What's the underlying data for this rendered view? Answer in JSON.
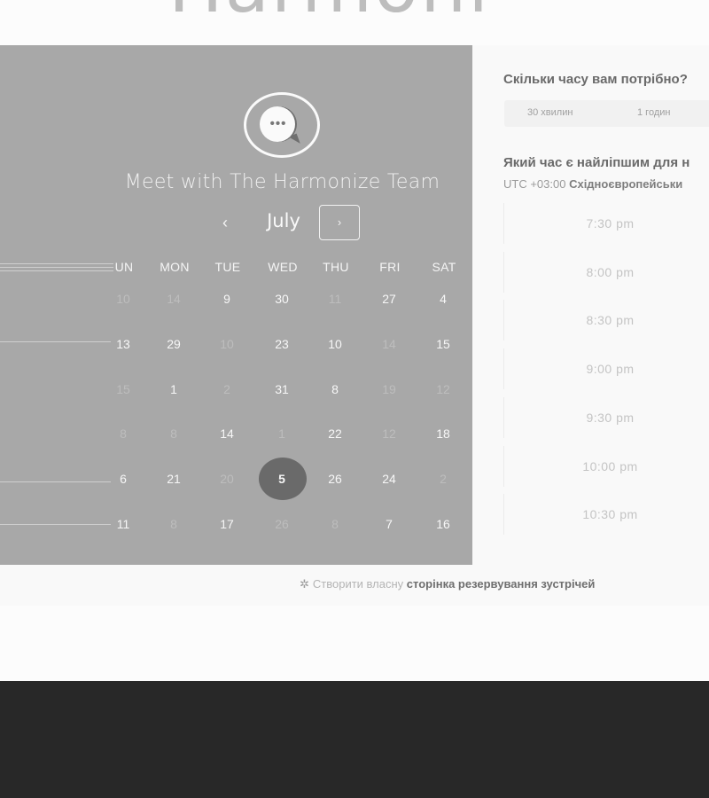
{
  "brand": {
    "partial_text": "Harmoni",
    "color": "#bdbdbd"
  },
  "calendar": {
    "title": "Meet with The Harmonize Team",
    "month": "July",
    "prev_icon": "‹",
    "next_icon": "›",
    "weekdays": [
      "UN",
      "MON",
      "TUE",
      "WED",
      "THU",
      "FRI",
      "SAT"
    ],
    "weeks": [
      [
        {
          "d": "10",
          "on": false
        },
        {
          "d": "14",
          "on": false
        },
        {
          "d": "9",
          "on": true
        },
        {
          "d": "30",
          "on": true
        },
        {
          "d": "11",
          "on": false
        },
        {
          "d": "27",
          "on": true
        },
        {
          "d": "4",
          "on": true
        }
      ],
      [
        {
          "d": "13",
          "on": true
        },
        {
          "d": "29",
          "on": true
        },
        {
          "d": "10",
          "on": false
        },
        {
          "d": "23",
          "on": true
        },
        {
          "d": "10",
          "on": true
        },
        {
          "d": "14",
          "on": false
        },
        {
          "d": "15",
          "on": true
        }
      ],
      [
        {
          "d": "15",
          "on": false
        },
        {
          "d": "1",
          "on": true
        },
        {
          "d": "2",
          "on": false
        },
        {
          "d": "31",
          "on": true
        },
        {
          "d": "8",
          "on": true
        },
        {
          "d": "19",
          "on": false
        },
        {
          "d": "12",
          "on": false
        }
      ],
      [
        {
          "d": "8",
          "on": false
        },
        {
          "d": "8",
          "on": false
        },
        {
          "d": "14",
          "on": true
        },
        {
          "d": "1",
          "on": false
        },
        {
          "d": "22",
          "on": true
        },
        {
          "d": "12",
          "on": false
        },
        {
          "d": "18",
          "on": true
        }
      ],
      [
        {
          "d": "6",
          "on": true
        },
        {
          "d": "21",
          "on": true
        },
        {
          "d": "20",
          "on": false
        },
        {
          "d": "5",
          "on": true,
          "selected": true
        },
        {
          "d": "26",
          "on": true
        },
        {
          "d": "24",
          "on": true
        },
        {
          "d": "2",
          "on": false
        }
      ],
      [
        {
          "d": "11",
          "on": true
        },
        {
          "d": "8",
          "on": false
        },
        {
          "d": "17",
          "on": true
        },
        {
          "d": "26",
          "on": false
        },
        {
          "d": "8",
          "on": false
        },
        {
          "d": "7",
          "on": true
        },
        {
          "d": "16",
          "on": true
        }
      ]
    ],
    "selected_color": "#6a6a6a"
  },
  "booking": {
    "duration_question": "Скільки часу вам потрібно?",
    "durations": [
      "30 хвилин",
      "1 годин"
    ],
    "time_question": "Який час є найліпшим для н",
    "timezone_prefix": "UTC +03:00",
    "timezone_name": "Східноєвропейськи",
    "slots": [
      "7:30 pm",
      "8:00 pm",
      "8:30 pm",
      "9:00 pm",
      "9:30 pm",
      "10:00 pm",
      "10:30 pm"
    ]
  },
  "footer": {
    "icon": "sprocket-icon",
    "prefix": "Створити власну",
    "strong": "сторінка резервування зустрічей"
  },
  "colors": {
    "left_panel": "#a8a8a8",
    "dark_footer": "#282828"
  }
}
